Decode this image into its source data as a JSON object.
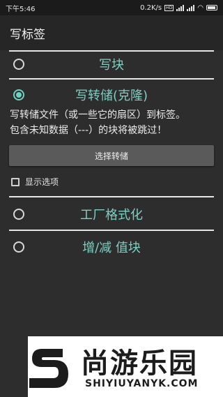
{
  "status": {
    "time": "下午5:46",
    "net_speed": "0.2K/s",
    "hd": "HD"
  },
  "appbar": {
    "title": "写标签"
  },
  "options": [
    {
      "label": "写块",
      "selected": false
    },
    {
      "label": "写转储(克隆)",
      "selected": true
    },
    {
      "label": "工厂格式化",
      "selected": false
    },
    {
      "label": "增/减 值块",
      "selected": false
    }
  ],
  "dump": {
    "description_line1": "写转储文件（或一些它的扇区）到标签。",
    "description_line2": "包含未知数据（---）的块将被跳过！",
    "select_button": "选择转储",
    "show_options_label": "显示选项",
    "show_options_checked": false
  },
  "watermark": {
    "brand": "尚游乐园",
    "url": "SHIYIUYANYK.COM"
  },
  "colors": {
    "accent": "#7ad0c2",
    "background": "#2d2d2d",
    "button": "#5a5a5a"
  }
}
